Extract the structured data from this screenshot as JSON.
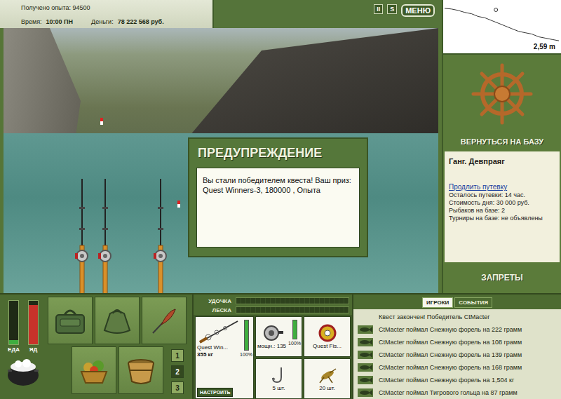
{
  "top_info": {
    "experience": "Получено опыта: 94500",
    "time_label": "Время:",
    "time": "10:00 ПН",
    "money_label": "Деньги:",
    "money": "78 222 568 руб."
  },
  "top_controls": [
    "II",
    "S",
    "МЕНЮ"
  ],
  "depth": {
    "reading": "2,59 m",
    "profile": [
      0.2,
      0.25,
      0.35,
      0.5,
      0.6,
      0.8,
      0.9,
      1.1,
      1.3,
      1.5,
      1.7,
      1.9,
      2.0,
      2.1,
      2.3,
      2.4,
      2.5,
      2.59
    ],
    "marker": {
      "level": 0.45
    }
  },
  "sidebar": {
    "return_button": "ВЕРНУТЬСЯ НА БАЗУ",
    "location": "Ганг. Девпраяг",
    "extend_link": "Продлить путевку",
    "details": [
      "Осталось путевки: 14 час.",
      "Стоимость дня: 30 000 руб.",
      "Рыбаков на базе: 2",
      "Турниры на базе: не объявлены"
    ],
    "bans_button": "ЗАПРЕТЫ"
  },
  "dialog": {
    "title": "ПРЕДУПРЕЖДЕНИЕ",
    "message": "Вы стали победителем квеста! Ваш приз: Quest Winners-3, 180000 , Опыта"
  },
  "meters": [
    {
      "label": "ЕДА",
      "level": 0.1,
      "color": "#3fae3f"
    },
    {
      "label": "ЯД",
      "level": 0.9,
      "color": "#c8322a"
    }
  ],
  "sets": [
    {
      "label": "1",
      "selected": false
    },
    {
      "label": "2",
      "selected": true
    },
    {
      "label": "3",
      "selected": false
    }
  ],
  "tension": [
    {
      "label": "УДОЧКА",
      "level": 0
    },
    {
      "label": "ЛЕСКА",
      "level": 0
    }
  ],
  "tackle": {
    "rod": {
      "name": "Quest Win...",
      "load": "355 кг",
      "wear": "100%",
      "level": 1
    },
    "setup_button": "НАСТРОИТЬ",
    "reel": {
      "power": "мощн.: 135",
      "wear": "100%",
      "level": 1
    },
    "line": {
      "name": "Quest Fis..."
    },
    "hook": {
      "count": "5 шт."
    },
    "bait": {
      "count": "20 шт."
    }
  },
  "log": {
    "tabs": [
      {
        "label": "ИГРОКИ",
        "selected": true
      },
      {
        "label": "СОБЫТИЯ",
        "selected": false
      }
    ],
    "entries": [
      {
        "text": "Квест закончен! Победитель CtMacter",
        "kind": "system"
      },
      {
        "text": "CtMacter поймал Снежную форель на 222 грамм",
        "kind": "catch"
      },
      {
        "text": "CtMacter поймал Снежную форель на 108 грамм",
        "kind": "catch"
      },
      {
        "text": "CtMacter поймал Снежную форель на 139 грамм",
        "kind": "catch"
      },
      {
        "text": "CtMacter поймал Снежную форель на 168 грамм",
        "kind": "catch"
      },
      {
        "text": "CtMacter поймал Снежную форель на 1,504 кг",
        "kind": "catch"
      },
      {
        "text": "CtMacter поймал Тигрового гольца на 87 грамм",
        "kind": "catch"
      }
    ]
  }
}
